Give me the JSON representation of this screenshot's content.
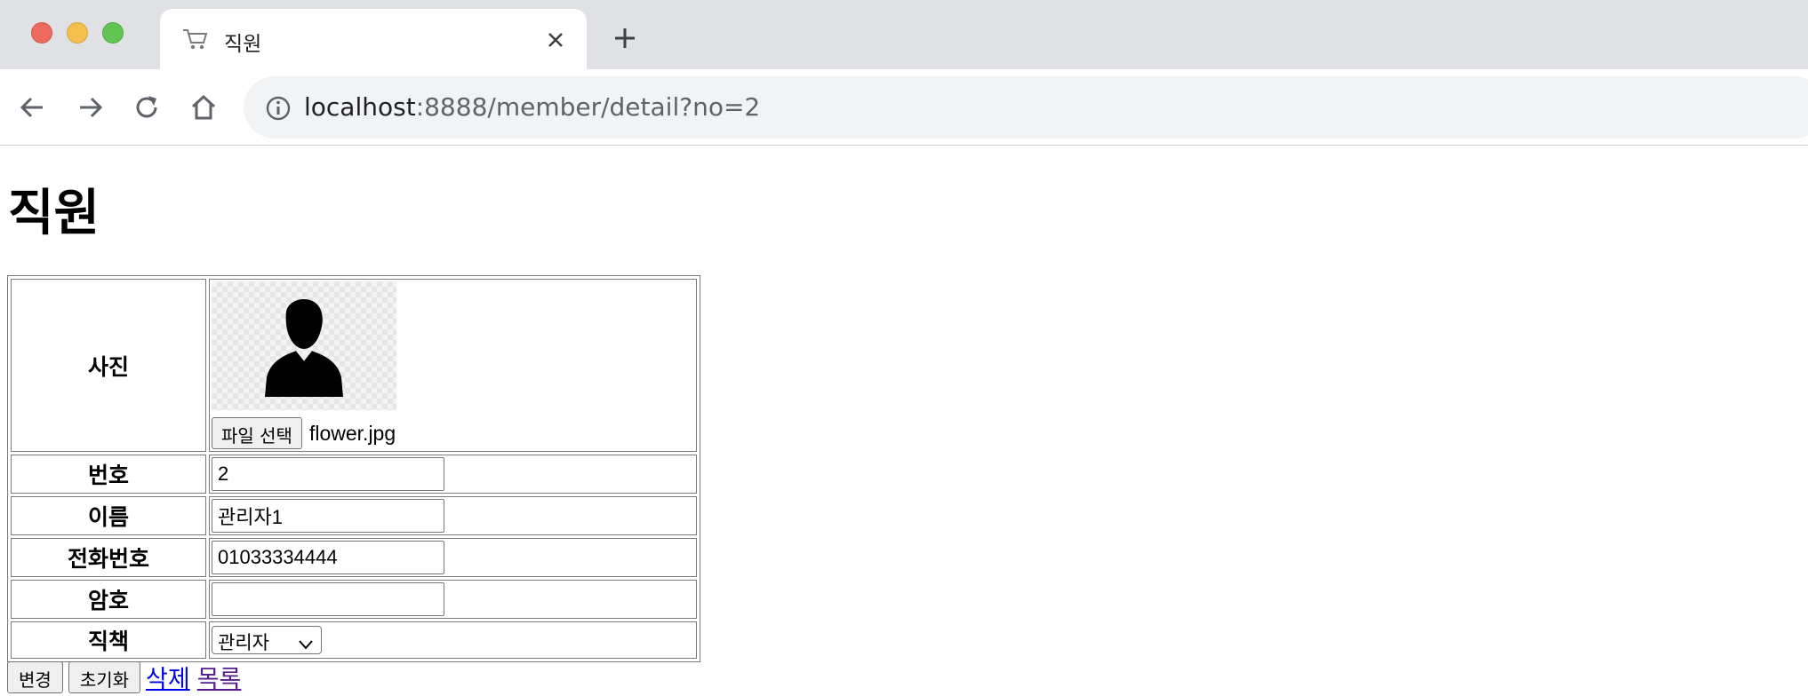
{
  "browser": {
    "tab_title": "직원",
    "url_host": "localhost",
    "url_rest": ":8888/member/detail?no=2"
  },
  "page": {
    "heading": "직원"
  },
  "form": {
    "photo": {
      "label": "사진",
      "file_button": "파일 선택",
      "file_name": "flower.jpg"
    },
    "number": {
      "label": "번호",
      "value": "2"
    },
    "name": {
      "label": "이름",
      "value": "관리자1"
    },
    "phone": {
      "label": "전화번호",
      "value": "01033334444"
    },
    "password": {
      "label": "암호",
      "value": ""
    },
    "position": {
      "label": "직책",
      "selected": "관리자"
    }
  },
  "actions": {
    "change": "변경",
    "reset": "초기화",
    "delete": "삭제",
    "list": "목록"
  }
}
